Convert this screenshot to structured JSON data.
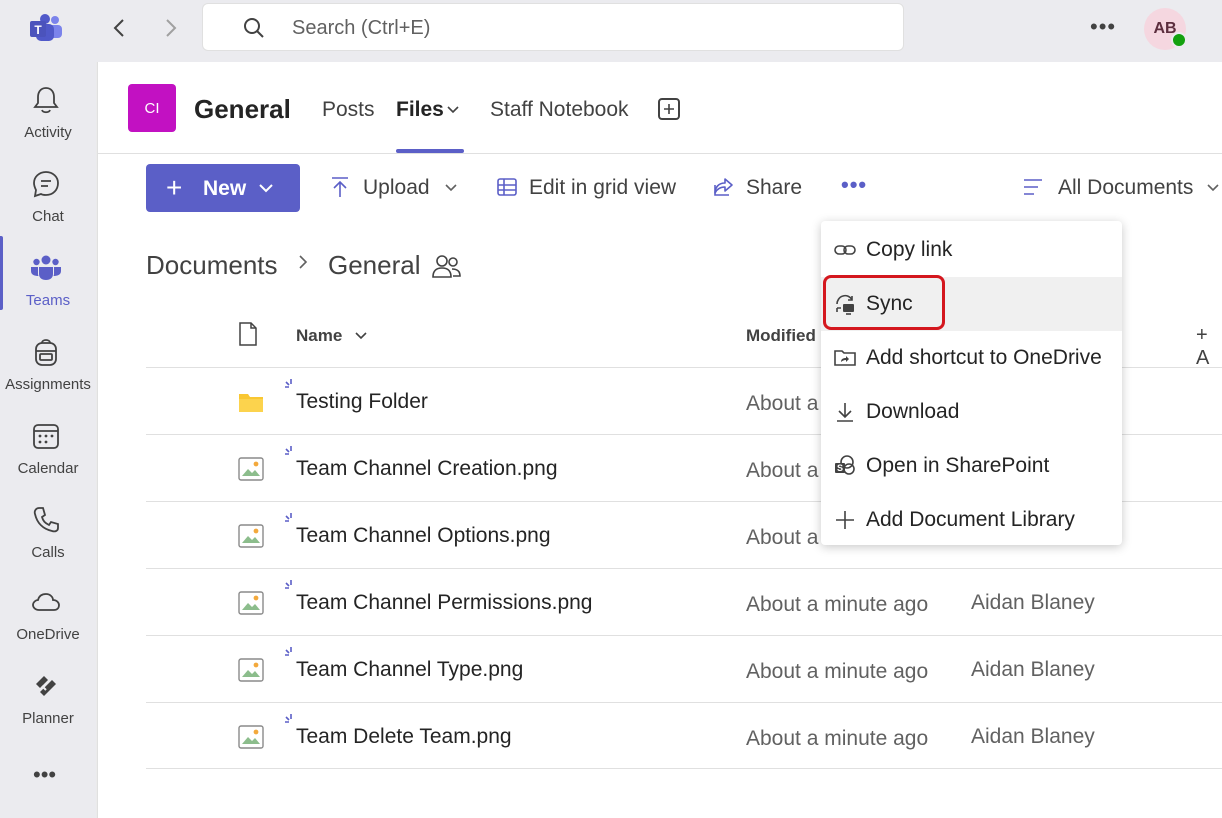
{
  "app": {
    "avatar_initials": "AB",
    "search_placeholder": "Search (Ctrl+E)"
  },
  "rail": {
    "items": [
      {
        "label": "Activity"
      },
      {
        "label": "Chat"
      },
      {
        "label": "Teams"
      },
      {
        "label": "Assignments"
      },
      {
        "label": "Calendar"
      },
      {
        "label": "Calls"
      },
      {
        "label": "OneDrive"
      },
      {
        "label": "Planner"
      }
    ],
    "more": "•••"
  },
  "header": {
    "team_initials": "CI",
    "channel": "General",
    "tabs": [
      {
        "label": "Posts"
      },
      {
        "label": "Files"
      },
      {
        "label": "Staff Notebook"
      }
    ]
  },
  "toolbar": {
    "new": "New",
    "upload": "Upload",
    "edit_grid": "Edit in grid view",
    "share": "Share",
    "more": "•••",
    "view": "All Documents"
  },
  "breadcrumb": {
    "root": "Documents",
    "current": "General"
  },
  "table": {
    "headers": {
      "name": "Name",
      "modified": "Modified"
    },
    "rows": [
      {
        "name": "Testing Folder",
        "modified": "About a",
        "modified_by": "",
        "type": "folder"
      },
      {
        "name": "Team Channel Creation.png",
        "modified": "About a",
        "modified_by": "",
        "type": "image"
      },
      {
        "name": "Team Channel Options.png",
        "modified": "About a",
        "modified_by": "",
        "type": "image"
      },
      {
        "name": "Team Channel Permissions.png",
        "modified": "About a minute ago",
        "modified_by": "Aidan Blaney",
        "type": "image"
      },
      {
        "name": "Team Channel Type.png",
        "modified": "About a minute ago",
        "modified_by": "Aidan Blaney",
        "type": "image"
      },
      {
        "name": "Team Delete Team.png",
        "modified": "About a minute ago",
        "modified_by": "Aidan Blaney",
        "type": "image"
      }
    ]
  },
  "menu": {
    "items": [
      {
        "label": "Copy link",
        "icon": "link-icon"
      },
      {
        "label": "Sync",
        "icon": "sync-icon"
      },
      {
        "label": "Add shortcut to OneDrive",
        "icon": "shortcut-icon"
      },
      {
        "label": "Download",
        "icon": "download-icon"
      },
      {
        "label": "Open in SharePoint",
        "icon": "sharepoint-icon"
      },
      {
        "label": "Add Document Library",
        "icon": "plus-icon"
      }
    ]
  },
  "colors": {
    "accent": "#5b5fc7",
    "highlight": "#d4171e",
    "team_avatar": "#c211c2"
  }
}
